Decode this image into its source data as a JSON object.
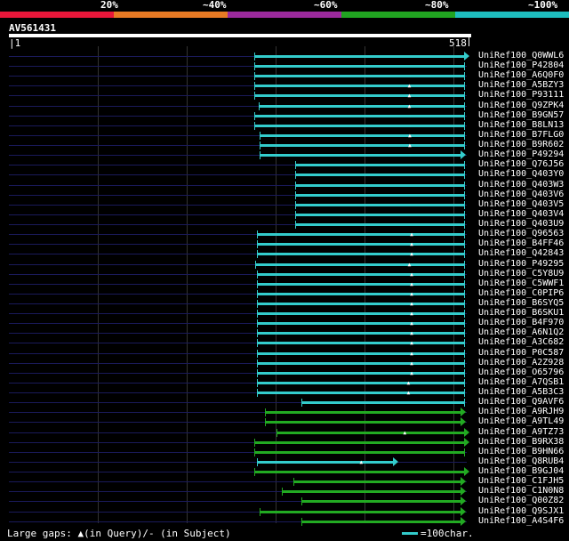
{
  "scale_labels": [
    "20%",
    "~40%",
    "~60%",
    "~80%",
    "~100%"
  ],
  "bands": [
    "#e8173a",
    "#e77a24",
    "#9b2a9c",
    "#21a421",
    "#1ebdbe"
  ],
  "query": {
    "id": "AV561431",
    "start": "1",
    "end": "518"
  },
  "footer": {
    "gaps": "Large gaps: ▲(in Query)/- (in Subject)",
    "legend": "=100char."
  },
  "rows": [
    {
      "name": "UniRef100_Q0WWL6",
      "start": 0.536,
      "end": 0.995,
      "color": "#33cccc",
      "arrow": true,
      "tri": null
    },
    {
      "name": "UniRef100_P42804",
      "start": 0.536,
      "end": 0.995,
      "color": "#33cccc",
      "arrow": false,
      "tri": null
    },
    {
      "name": "UniRef100_A6Q0F0",
      "start": 0.536,
      "end": 0.995,
      "color": "#33cccc",
      "arrow": false,
      "tri": null
    },
    {
      "name": "UniRef100_A5BZY3",
      "start": 0.536,
      "end": 0.995,
      "color": "#33cccc",
      "arrow": false,
      "tri": 0.875
    },
    {
      "name": "UniRef100_P93111",
      "start": 0.536,
      "end": 0.995,
      "color": "#33cccc",
      "arrow": false,
      "tri": 0.875
    },
    {
      "name": "UniRef100_Q9ZPK4",
      "start": 0.545,
      "end": 0.995,
      "color": "#33cccc",
      "arrow": false,
      "tri": 0.875
    },
    {
      "name": "UniRef100_B9GN57",
      "start": 0.536,
      "end": 0.995,
      "color": "#33cccc",
      "arrow": false,
      "tri": null
    },
    {
      "name": "UniRef100_B8LN13",
      "start": 0.536,
      "end": 0.995,
      "color": "#33cccc",
      "arrow": false,
      "tri": null
    },
    {
      "name": "UniRef100_B7FLG0",
      "start": 0.547,
      "end": 0.995,
      "color": "#33cccc",
      "arrow": false,
      "tri": 0.876
    },
    {
      "name": "UniRef100_B9R602",
      "start": 0.547,
      "end": 0.995,
      "color": "#33cccc",
      "arrow": false,
      "tri": 0.876
    },
    {
      "name": "UniRef100_P49294",
      "start": 0.547,
      "end": 0.987,
      "color": "#33cccc",
      "arrow": true,
      "tri": null
    },
    {
      "name": "UniRef100_Q76J56",
      "start": 0.625,
      "end": 0.995,
      "color": "#33cccc",
      "arrow": false,
      "tri": null
    },
    {
      "name": "UniRef100_Q403Y0",
      "start": 0.625,
      "end": 0.995,
      "color": "#33cccc",
      "arrow": false,
      "tri": null
    },
    {
      "name": "UniRef100_Q403W3",
      "start": 0.625,
      "end": 0.995,
      "color": "#33cccc",
      "arrow": false,
      "tri": null
    },
    {
      "name": "UniRef100_Q403V6",
      "start": 0.625,
      "end": 0.995,
      "color": "#33cccc",
      "arrow": false,
      "tri": null
    },
    {
      "name": "UniRef100_Q403V5",
      "start": 0.625,
      "end": 0.995,
      "color": "#33cccc",
      "arrow": false,
      "tri": null
    },
    {
      "name": "UniRef100_Q403V4",
      "start": 0.625,
      "end": 0.995,
      "color": "#33cccc",
      "arrow": false,
      "tri": null
    },
    {
      "name": "UniRef100_Q403U9",
      "start": 0.625,
      "end": 0.995,
      "color": "#33cccc",
      "arrow": false,
      "tri": null
    },
    {
      "name": "UniRef100_Q96563",
      "start": 0.542,
      "end": 0.995,
      "color": "#33cccc",
      "arrow": false,
      "tri": 0.88
    },
    {
      "name": "UniRef100_B4FF46",
      "start": 0.542,
      "end": 0.995,
      "color": "#33cccc",
      "arrow": false,
      "tri": 0.88
    },
    {
      "name": "UniRef100_Q42843",
      "start": 0.542,
      "end": 0.995,
      "color": "#33cccc",
      "arrow": false,
      "tri": 0.88
    },
    {
      "name": "UniRef100_P49295",
      "start": 0.538,
      "end": 0.995,
      "color": "#33cccc",
      "arrow": false,
      "tri": 0.875
    },
    {
      "name": "UniRef100_C5Y8U9",
      "start": 0.542,
      "end": 0.995,
      "color": "#33cccc",
      "arrow": false,
      "tri": 0.88
    },
    {
      "name": "UniRef100_C5WWF1",
      "start": 0.542,
      "end": 0.995,
      "color": "#33cccc",
      "arrow": false,
      "tri": 0.88
    },
    {
      "name": "UniRef100_C0PIP6",
      "start": 0.542,
      "end": 0.995,
      "color": "#33cccc",
      "arrow": false,
      "tri": 0.88
    },
    {
      "name": "UniRef100_B6SYQ5",
      "start": 0.542,
      "end": 0.995,
      "color": "#33cccc",
      "arrow": false,
      "tri": 0.88
    },
    {
      "name": "UniRef100_B6SKU1",
      "start": 0.542,
      "end": 0.995,
      "color": "#33cccc",
      "arrow": false,
      "tri": 0.88
    },
    {
      "name": "UniRef100_B4F970",
      "start": 0.542,
      "end": 0.995,
      "color": "#33cccc",
      "arrow": false,
      "tri": 0.88
    },
    {
      "name": "UniRef100_A6N1Q2",
      "start": 0.542,
      "end": 0.995,
      "color": "#33cccc",
      "arrow": false,
      "tri": 0.88
    },
    {
      "name": "UniRef100_A3C682",
      "start": 0.542,
      "end": 0.995,
      "color": "#33cccc",
      "arrow": false,
      "tri": 0.88
    },
    {
      "name": "UniRef100_P0C587",
      "start": 0.542,
      "end": 0.995,
      "color": "#33cccc",
      "arrow": false,
      "tri": 0.88
    },
    {
      "name": "UniRef100_A2Z928",
      "start": 0.542,
      "end": 0.995,
      "color": "#33cccc",
      "arrow": false,
      "tri": 0.88
    },
    {
      "name": "UniRef100_O65796",
      "start": 0.542,
      "end": 0.995,
      "color": "#33cccc",
      "arrow": false,
      "tri": 0.88
    },
    {
      "name": "UniRef100_A7QSB1",
      "start": 0.542,
      "end": 0.995,
      "color": "#33cccc",
      "arrow": false,
      "tri": 0.873
    },
    {
      "name": "UniRef100_A5B3C3",
      "start": 0.542,
      "end": 0.995,
      "color": "#33cccc",
      "arrow": false,
      "tri": 0.873
    },
    {
      "name": "UniRef100_Q9AVF6",
      "start": 0.638,
      "end": 0.995,
      "color": "#33cccc",
      "arrow": false,
      "tri": null
    },
    {
      "name": "UniRef100_A9RJH9",
      "start": 0.56,
      "end": 0.987,
      "color": "#22aa22",
      "arrow": true,
      "tri": null
    },
    {
      "name": "UniRef100_A9TL49",
      "start": 0.56,
      "end": 0.987,
      "color": "#22aa22",
      "arrow": true,
      "tri": null
    },
    {
      "name": "UniRef100_A9TZ73",
      "start": 0.584,
      "end": 0.995,
      "color": "#22aa22",
      "arrow": true,
      "tri": 0.865
    },
    {
      "name": "UniRef100_B9RX38",
      "start": 0.536,
      "end": 0.995,
      "color": "#22aa22",
      "arrow": true,
      "tri": null
    },
    {
      "name": "UniRef100_B9HN66",
      "start": 0.536,
      "end": 0.995,
      "color": "#22aa22",
      "arrow": false,
      "tri": null
    },
    {
      "name": "UniRef100_Q8RUB4",
      "start": 0.542,
      "end": 0.838,
      "color": "#33cccc",
      "arrow": true,
      "tri": 0.77
    },
    {
      "name": "UniRef100_B9GJ04",
      "start": 0.536,
      "end": 0.995,
      "color": "#22aa22",
      "arrow": true,
      "tri": null
    },
    {
      "name": "UniRef100_C1FJH5",
      "start": 0.622,
      "end": 0.987,
      "color": "#22aa22",
      "arrow": true,
      "tri": null
    },
    {
      "name": "UniRef100_C1N0N8",
      "start": 0.596,
      "end": 0.987,
      "color": "#22aa22",
      "arrow": true,
      "tri": null
    },
    {
      "name": "UniRef100_Q00Z82",
      "start": 0.639,
      "end": 0.987,
      "color": "#22aa22",
      "arrow": true,
      "tri": null
    },
    {
      "name": "UniRef100_Q9SJX1",
      "start": 0.548,
      "end": 0.987,
      "color": "#22aa22",
      "arrow": true,
      "tri": null
    },
    {
      "name": "UniRef100_A4S4F6",
      "start": 0.638,
      "end": 0.987,
      "color": "#22aa22",
      "arrow": true,
      "tri": null
    }
  ]
}
